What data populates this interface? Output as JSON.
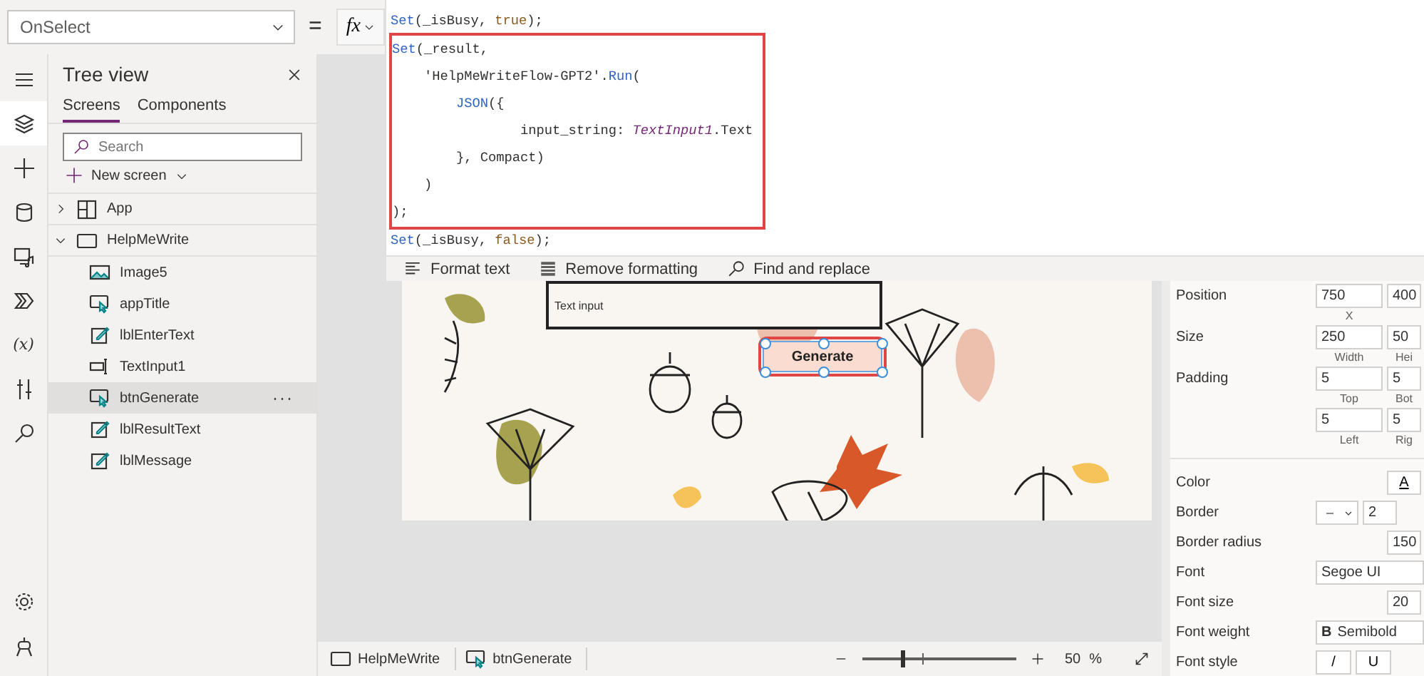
{
  "property_bar": {
    "property": "OnSelect",
    "equals": "=",
    "fx": "fx"
  },
  "formula": {
    "blocks": [
      {
        "highlighted": false,
        "lines": [
          [
            {
              "kind": "fn",
              "text": "Set"
            },
            {
              "kind": "plain",
              "text": "(_isBusy, "
            },
            {
              "kind": "literal",
              "text": "true"
            },
            {
              "kind": "plain",
              "text": ");"
            }
          ]
        ]
      },
      {
        "highlighted": true,
        "lines": [
          [
            {
              "kind": "fn",
              "text": "Set"
            },
            {
              "kind": "plain",
              "text": "(_result,"
            }
          ],
          [
            {
              "kind": "plain",
              "text": "    'HelpMeWriteFlow-GPT2'."
            },
            {
              "kind": "fn",
              "text": "Run"
            },
            {
              "kind": "plain",
              "text": "("
            }
          ],
          [
            {
              "kind": "fn",
              "text": "        JSON"
            },
            {
              "kind": "plain",
              "text": "({"
            }
          ],
          [
            {
              "kind": "plain",
              "text": "                input_string: "
            },
            {
              "kind": "control",
              "text": "TextInput1"
            },
            {
              "kind": "plain",
              "text": ".Text"
            }
          ],
          [
            {
              "kind": "plain",
              "text": "        }, Compact)"
            }
          ],
          [
            {
              "kind": "plain",
              "text": "    )"
            }
          ],
          [
            {
              "kind": "plain",
              "text": ");"
            }
          ]
        ]
      },
      {
        "highlighted": false,
        "lines": [
          [
            {
              "kind": "fn",
              "text": "Set"
            },
            {
              "kind": "plain",
              "text": "(_isBusy, "
            },
            {
              "kind": "literal",
              "text": "false"
            },
            {
              "kind": "plain",
              "text": ");"
            }
          ]
        ]
      }
    ],
    "toolbar": [
      {
        "kind": "format",
        "label": "Format text"
      },
      {
        "kind": "remove",
        "label": "Remove formatting"
      },
      {
        "kind": "find",
        "label": "Find and replace"
      }
    ]
  },
  "rail": {
    "top": [
      {
        "kind": "menu",
        "selected": false
      },
      {
        "kind": "layers",
        "selected": true
      },
      {
        "kind": "insert",
        "selected": false
      },
      {
        "kind": "data",
        "selected": false
      },
      {
        "kind": "media",
        "selected": false
      },
      {
        "kind": "flow",
        "selected": false
      },
      {
        "kind": "variables",
        "glyph": "(x)",
        "selected": false
      },
      {
        "kind": "tools",
        "selected": false
      },
      {
        "kind": "search",
        "selected": false
      }
    ],
    "bottom": [
      {
        "kind": "settings",
        "selected": false
      },
      {
        "kind": "agent",
        "selected": false
      }
    ]
  },
  "tree_view": {
    "title": "Tree view",
    "tabs": [
      {
        "label": "Screens",
        "selected": true
      },
      {
        "label": "Components",
        "selected": false
      }
    ],
    "search": {
      "placeholder": "Search"
    },
    "new_screen": "New screen",
    "items": [
      {
        "label": "App",
        "kind": "app",
        "expanded": false,
        "selected": false
      },
      {
        "label": "HelpMeWrite",
        "kind": "screen",
        "expanded": true,
        "selected": false,
        "children": [
          {
            "label": "Image5",
            "kind": "image",
            "selected": false
          },
          {
            "label": "appTitle",
            "kind": "button",
            "selected": false
          },
          {
            "label": "lblEnterText",
            "kind": "label",
            "selected": false
          },
          {
            "label": "TextInput1",
            "kind": "textinput",
            "selected": false
          },
          {
            "label": "btnGenerate",
            "kind": "button",
            "selected": true,
            "more": "···"
          },
          {
            "label": "lblResultText",
            "kind": "label",
            "selected": false
          },
          {
            "label": "lblMessage",
            "kind": "label",
            "selected": false
          }
        ]
      }
    ]
  },
  "canvas": {
    "text_input": {
      "value": "Text input"
    },
    "button": {
      "label": "Generate",
      "selected": true
    }
  },
  "status_bar": {
    "breadcrumb": [
      {
        "label": "HelpMeWrite",
        "kind": "screen"
      },
      {
        "label": "btnGenerate",
        "kind": "button"
      }
    ],
    "zoom": {
      "level": 0.25,
      "value": "50",
      "unit": "%"
    }
  },
  "properties": [
    {
      "kind": "pair",
      "label": "Position",
      "fields": [
        {
          "value": "750",
          "caption": "X"
        },
        {
          "value": "400"
        }
      ]
    },
    {
      "kind": "pair",
      "label": "Size",
      "fields": [
        {
          "value": "250",
          "caption": "Width"
        },
        {
          "value": "50",
          "caption": "Hei"
        }
      ]
    },
    {
      "kind": "pair",
      "label": "Padding",
      "fields": [
        {
          "value": "5",
          "caption": "Top"
        },
        {
          "value": "5",
          "caption": "Bot"
        }
      ]
    },
    {
      "kind": "pair",
      "fields": [
        {
          "value": "5",
          "caption": "Left"
        },
        {
          "value": "5",
          "caption": "Rig"
        }
      ]
    },
    {
      "kind": "color",
      "label": "Color",
      "glyph": "A"
    },
    {
      "kind": "border",
      "label": "Border",
      "value": "2"
    },
    {
      "kind": "number",
      "label": "Border radius",
      "value": "150"
    },
    {
      "kind": "text",
      "label": "Font",
      "value": "Segoe UI"
    },
    {
      "kind": "number",
      "label": "Font size",
      "value": "20"
    },
    {
      "kind": "weight",
      "label": "Font weight",
      "glyph": "B",
      "value": "Semibold"
    },
    {
      "kind": "style",
      "label": "Font style",
      "buttons": [
        "/",
        "U"
      ]
    }
  ]
}
